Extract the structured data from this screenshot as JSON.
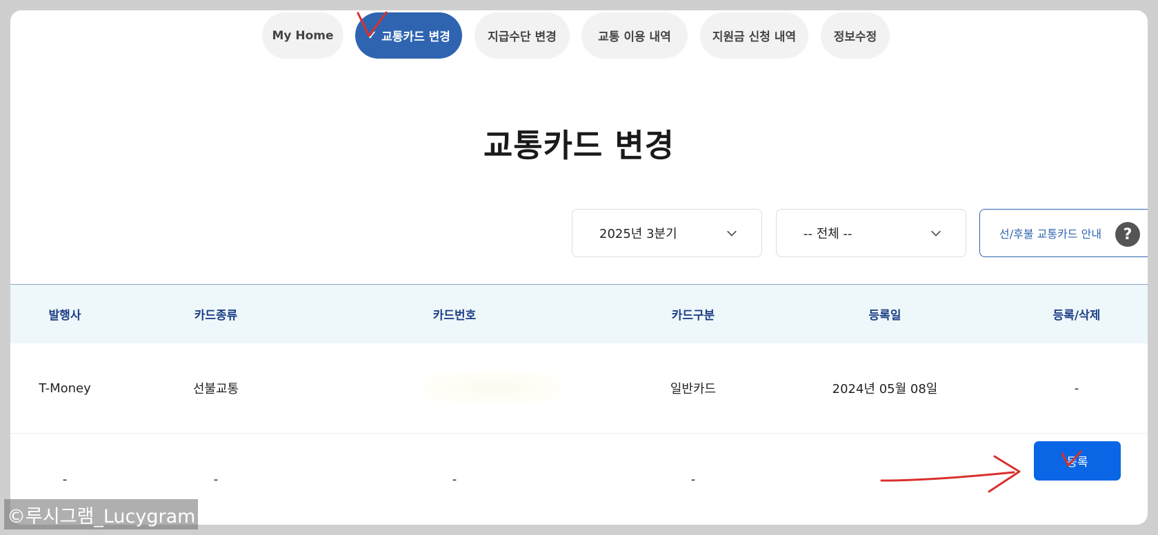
{
  "tabs": [
    {
      "label": "My Home"
    },
    {
      "label": "교통카드 변경",
      "active": true
    },
    {
      "label": "지급수단 변경"
    },
    {
      "label": "교통 이용 내역"
    },
    {
      "label": "지원금 신청 내역"
    },
    {
      "label": "정보수정"
    }
  ],
  "page": {
    "title": "교통카드 변경"
  },
  "filters": {
    "quarter": "2025년 3분기",
    "type": "-- 전체 --",
    "guide_label": "선/후불 교통카드 안내",
    "guide_icon": "?"
  },
  "table": {
    "headers": [
      "발행사",
      "카드종류",
      "카드번호",
      "카드구분",
      "등록일",
      "등록/삭제"
    ],
    "rows": [
      [
        "T-Money",
        "선불교통",
        "",
        "일반카드",
        "2024년 05월 08일",
        "-"
      ],
      [
        "-",
        "-",
        "-",
        "-",
        "",
        ""
      ]
    ]
  },
  "register_button": "등록",
  "watermark": "©루시그램_Lucygram",
  "colors": {
    "accent": "#2f64b0",
    "primary_button": "#0a66e4",
    "header_bg": "#eef7fa",
    "annotation": "#d9302c"
  }
}
